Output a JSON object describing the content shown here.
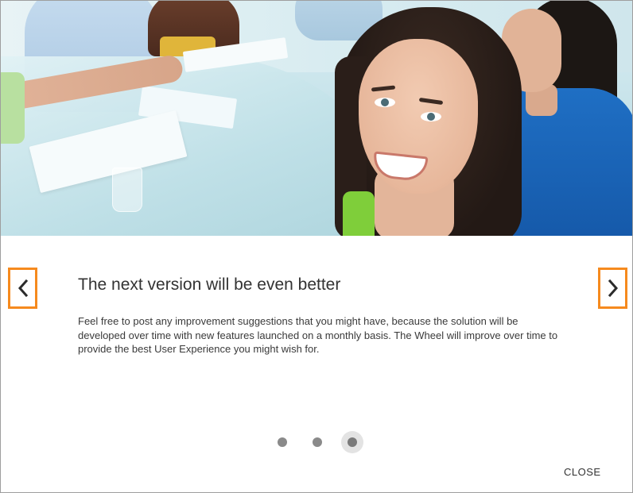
{
  "dialog": {
    "title": "The next version will be even better",
    "body": "Feel free to post any improvement suggestions that you might have, because the solution will be developed over time with new features launched on a monthly basis. The Wheel will improve over time to provide the best User Experience you might wish for.",
    "close_label": "CLOSE"
  },
  "navigation": {
    "prev_icon": "chevron-left-icon",
    "next_icon": "chevron-right-icon",
    "highlight_color": "#f68a1e"
  },
  "pager": {
    "total": 3,
    "active_index": 3
  }
}
